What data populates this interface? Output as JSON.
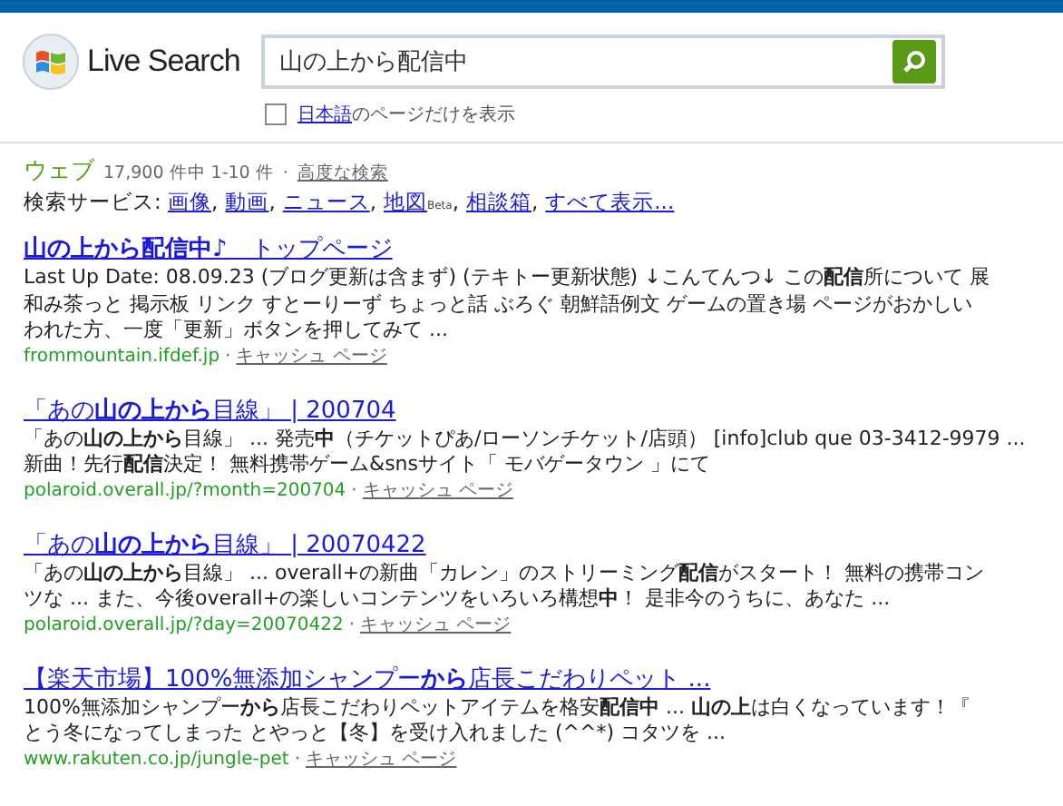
{
  "header": {
    "logo_text": "Live Search",
    "search": {
      "value": "山の上から配信中"
    },
    "language_filter": {
      "checked": false,
      "link": "日本語",
      "text": "のページだけを表示"
    }
  },
  "summary": {
    "section": "ウェブ",
    "count": "17,900 件中 1-10 件",
    "separator": "·",
    "advanced_link": "高度な検索"
  },
  "services": {
    "label": "検索サービス:",
    "link_separator": ",",
    "links": [
      {
        "text": "画像"
      },
      {
        "text": "動画"
      },
      {
        "text": "ニュース"
      },
      {
        "text": "地図",
        "badge": "Beta"
      },
      {
        "text": "相談箱"
      },
      {
        "text": "すべて表示..."
      }
    ]
  },
  "results": [
    {
      "title": "**山の上から配信中**♪　トップページ",
      "lines": [
        "Last Up Date: 08.09.23 (ブログ更新は含まず) (テキトー更新状態) ↓こんてんつ↓ この**配信**所について 展",
        "和み茶っと 掲示板 リンク すとーりーず ちょっと話 ぶろぐ 朝鮮語例文 ゲームの置き場 ページがおかしい",
        "われた方、一度「更新」ボタンを押してみて ..."
      ],
      "url": "frommountain.ifdef.jp",
      "cache": "キャッシュ ページ"
    },
    {
      "title": "「あの**山の上から**目線」 | 200704",
      "lines": [
        "「あの**山の上から**目線」 ... 発売**中**（チケットぴあ/ローソンチケット/店頭） [info]club que 03-3412-9979 ...",
        "新曲！先行**配信**決定！ 無料携帯ゲーム&snsサイト「 モバゲータウン 」にて"
      ],
      "url": "polaroid.overall.jp/?month=200704",
      "cache": "キャッシュ ページ"
    },
    {
      "title": "「あの**山の上から**目線」 | 20070422",
      "lines": [
        "「あの**山の上から**目線」 ... overall+の新曲「カレン」のストリーミング**配信**がスタート！ 無料の携帯コン",
        "ツな ... また、今後overall+の楽しいコンテンツをいろいろ構想**中**！ 是非今のうちに、あなた ..."
      ],
      "url": "polaroid.overall.jp/?day=20070422",
      "cache": "キャッシュ ページ"
    },
    {
      "title": "【楽天市場】100%無添加シャンプー**から**店長こだわりペット ...",
      "lines": [
        "100%無添加シャンプー**から**店長こだわりペットアイテムを格安**配信中** ... **山の上**は白くなっています！『",
        "とう冬になってしまった とやっと【冬】を受け入れました (^^*) コタツを ..."
      ],
      "url": "www.rakuten.co.jp/jungle-pet",
      "cache": "キャッシュ ページ"
    }
  ]
}
